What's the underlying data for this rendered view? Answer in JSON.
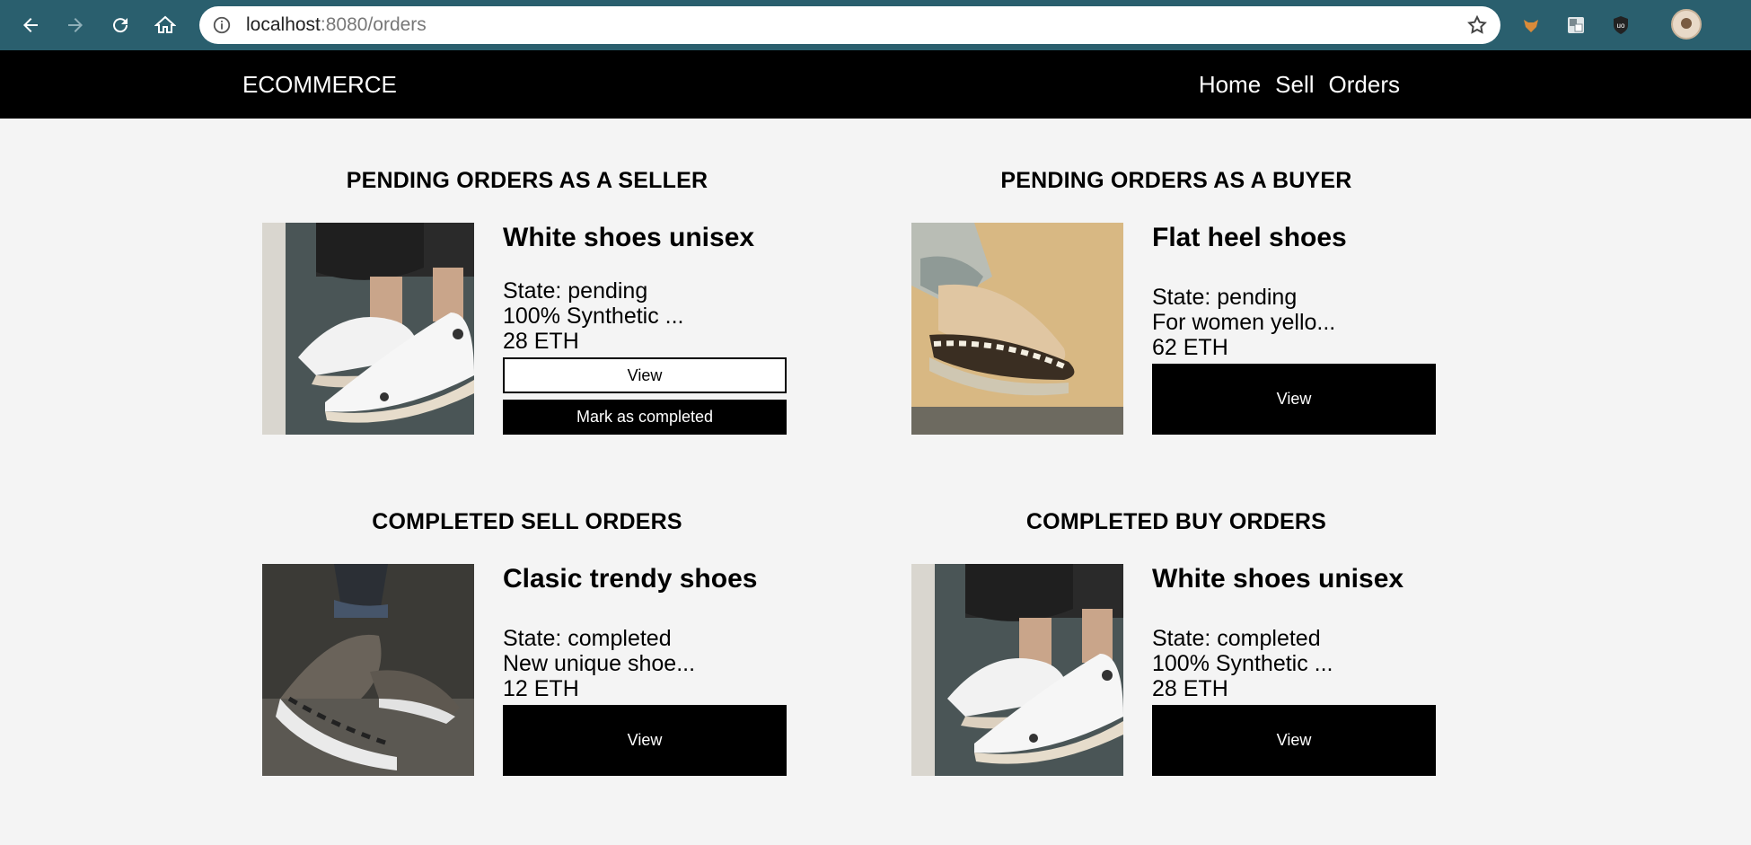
{
  "browser": {
    "url_host": "localhost",
    "url_path": ":8080/orders"
  },
  "header": {
    "brand": "ECOMMERCE",
    "nav": [
      "Home",
      "Sell",
      "Orders"
    ]
  },
  "sections": [
    {
      "heading": "PENDING ORDERS AS A SELLER",
      "order": {
        "title": "White shoes unisex",
        "state": "State: pending",
        "description": "100% Synthetic ...",
        "price": "28 ETH",
        "view_label": "View",
        "complete_label": "Mark as completed"
      }
    },
    {
      "heading": "PENDING ORDERS AS A BUYER",
      "order": {
        "title": "Flat heel shoes",
        "state": "State: pending",
        "description": "For women yello...",
        "price": "62 ETH",
        "view_label": "View"
      }
    },
    {
      "heading": "COMPLETED SELL ORDERS",
      "order": {
        "title": "Clasic trendy shoes",
        "state": "State: completed",
        "description": "New unique shoe...",
        "price": "12 ETH",
        "view_label": "View"
      }
    },
    {
      "heading": "COMPLETED BUY ORDERS",
      "order": {
        "title": "White shoes unisex",
        "state": "State: completed",
        "description": "100% Synthetic ...",
        "price": "28 ETH",
        "view_label": "View"
      }
    }
  ]
}
